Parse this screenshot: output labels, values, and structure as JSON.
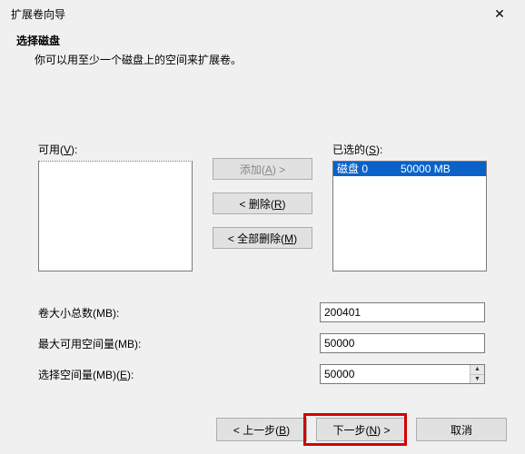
{
  "window": {
    "title": "扩展卷向导"
  },
  "header": {
    "title": "选择磁盘",
    "subtitle": "你可以用至少一个磁盘上的空间来扩展卷。"
  },
  "lists": {
    "available_label": "可用(V):",
    "selected_label": "已选的(S):",
    "selected_item_name": "磁盘 0",
    "selected_item_size": "50000 MB"
  },
  "buttons": {
    "add": "添加(A) >",
    "remove": "< 删除(R)",
    "remove_all": "< 全部删除(M)"
  },
  "fields": {
    "total_label": "卷大小总数(MB):",
    "total_value": "200401",
    "max_label": "最大可用空间量(MB):",
    "max_value": "50000",
    "space_label": "选择空间量(MB)(E):",
    "space_value": "50000"
  },
  "footer": {
    "back": "< 上一步(B)",
    "next": "下一步(N) >",
    "cancel": "取消"
  }
}
